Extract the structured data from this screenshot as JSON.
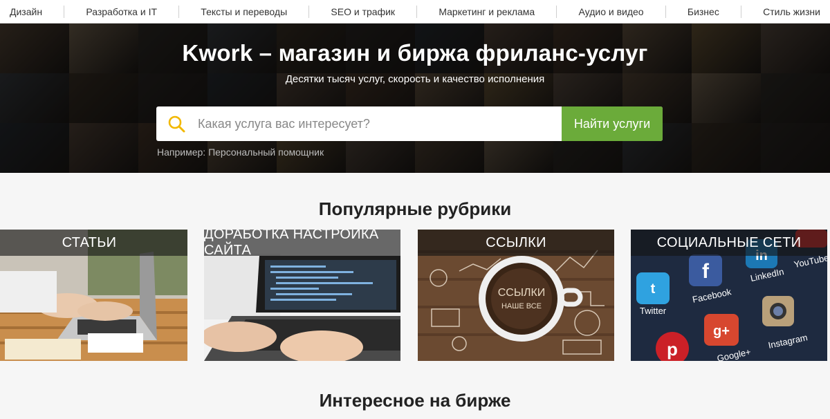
{
  "nav": {
    "items": [
      {
        "label": "Дизайн"
      },
      {
        "label": "Разработка и IT"
      },
      {
        "label": "Тексты и переводы"
      },
      {
        "label": "SEO и трафик"
      },
      {
        "label": "Маркетинг и реклама"
      },
      {
        "label": "Аудио и видео"
      },
      {
        "label": "Бизнес"
      },
      {
        "label": "Стиль жизни"
      }
    ]
  },
  "hero": {
    "title": "Kwork – магазин и биржа фриланс-услуг",
    "subtitle": "Десятки тысяч услуг, скорость и качество исполнения",
    "search": {
      "placeholder": "Какая услуга вас интересует?",
      "value": "",
      "button_label": "Найти услуги",
      "example_prefix": "Например:",
      "example_link": "Персональный помощник"
    }
  },
  "popular": {
    "title": "Популярные рубрики",
    "cards": [
      {
        "label": "Статьи",
        "photo_text": ""
      },
      {
        "label": "Доработка настройка сайта",
        "photo_text": ""
      },
      {
        "label": "Ссылки",
        "photo_text_1": "ССЫЛКИ",
        "photo_text_2": "НАШЕ ВСЕ"
      },
      {
        "label": "Социальные сети",
        "apps": [
          "Twitter",
          "Facebook",
          "LinkedIn",
          "YouTube",
          "Google+",
          "Instagram"
        ]
      }
    ]
  },
  "interesting": {
    "title": "Интересное на бирже"
  },
  "colors": {
    "accent_green": "#6bab3a",
    "search_icon": "#f2b800",
    "hero_text": "#ffffff"
  },
  "icons": {
    "search": "magnifier-icon"
  }
}
